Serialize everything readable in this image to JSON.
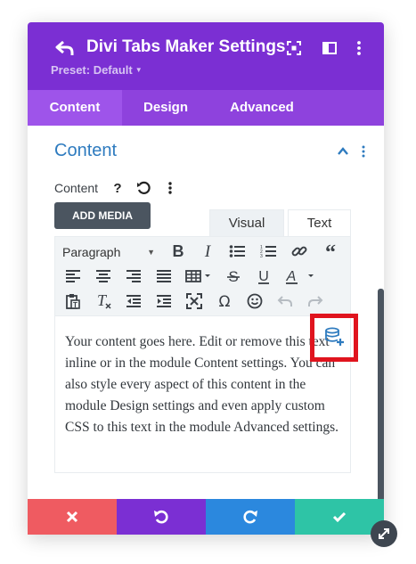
{
  "header": {
    "title": "Divi Tabs Maker Settings",
    "preset_label": "Preset: Default",
    "icons": [
      "back-icon",
      "focus-mode-icon",
      "sidebar-icon",
      "more-vertical-icon"
    ]
  },
  "tabs": [
    {
      "label": "Content",
      "active": true
    },
    {
      "label": "Design",
      "active": false
    },
    {
      "label": "Advanced",
      "active": false
    }
  ],
  "section": {
    "title": "Content",
    "field_label": "Content",
    "add_media_label": "ADD MEDIA",
    "editor_tabs": [
      "Visual",
      "Text"
    ],
    "format_select": "Paragraph",
    "body_text": "Your content goes here. Edit or remove this text inline or in the module Content settings. You can also style every aspect of this content in the module Design settings and even apply custom CSS to this text in the module Advanced settings."
  },
  "toolbar_icons": {
    "row1": [
      "bold-icon",
      "italic-icon",
      "bullet-list-icon",
      "numbered-list-icon",
      "link-icon",
      "blockquote-icon"
    ],
    "row2": [
      "align-left-icon",
      "align-center-icon",
      "align-right-icon",
      "justify-icon",
      "table-icon",
      "strikethrough-icon",
      "underline-icon",
      "text-color-icon"
    ],
    "row3": [
      "paste-text-icon",
      "clear-formatting-icon",
      "outdent-icon",
      "indent-icon",
      "fullscreen-icon",
      "omega-icon",
      "emoji-icon",
      "undo-icon",
      "redo-icon"
    ]
  },
  "footer": {
    "buttons": [
      "cancel-icon",
      "undo-icon",
      "redo-icon",
      "save-check-icon"
    ]
  },
  "colors": {
    "header": "#7b2fd3",
    "tabs_bar": "#8e42dd",
    "accent_blue": "#2e7bbf",
    "cancel": "#ef5b61",
    "undo": "#7b2fd3",
    "redo": "#2b88de",
    "save": "#2ec4a6",
    "highlight": "#e0141e"
  }
}
